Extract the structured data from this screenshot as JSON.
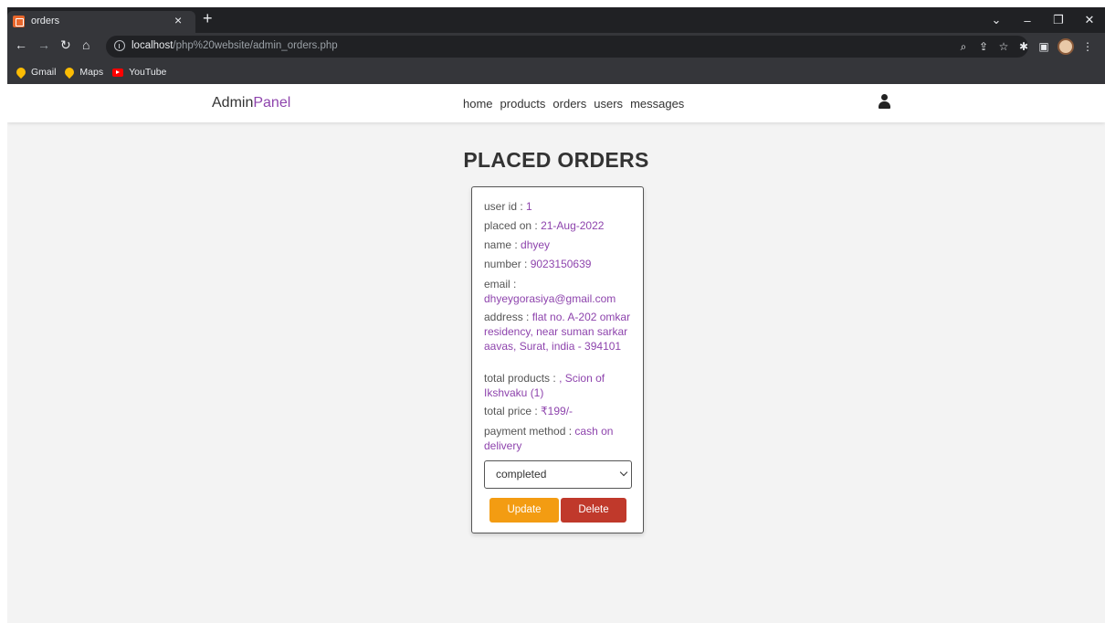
{
  "browser": {
    "tab_title": "orders",
    "tab_close": "×",
    "new_tab": "+",
    "url_host": "localhost",
    "url_path": "/php%20website/admin_orders.php",
    "bookmarks": [
      "Gmail",
      "Maps",
      "YouTube"
    ]
  },
  "header": {
    "logo_main": "Admin",
    "logo_accent": "Panel",
    "nav": [
      "home",
      "products",
      "orders",
      "users",
      "messages"
    ]
  },
  "page": {
    "title": "PLACED ORDERS"
  },
  "order": {
    "user_id_label": "user id :",
    "user_id": "1",
    "placed_on_label": "placed on :",
    "placed_on": "21-Aug-2022",
    "name_label": "name :",
    "name": "dhyey",
    "number_label": "number :",
    "number": "9023150639",
    "email_label": "email :",
    "email": "dhyeygorasiya@gmail.com",
    "address_label": "address :",
    "address": "flat no. A-202 omkar residency, near suman sarkar aavas, Surat, india - 394101",
    "total_products_label": "total products :",
    "total_products": ", Scion of Ikshvaku (1)",
    "total_price_label": "total price :",
    "total_price": "₹199/-",
    "payment_method_label": "payment method :",
    "payment_method": "cash on delivery",
    "status_selected": "completed",
    "update_label": "Update",
    "delete_label": "Delete"
  },
  "colors": {
    "accent": "#8e44ad",
    "update": "#f39c12",
    "delete": "#c0392b"
  }
}
